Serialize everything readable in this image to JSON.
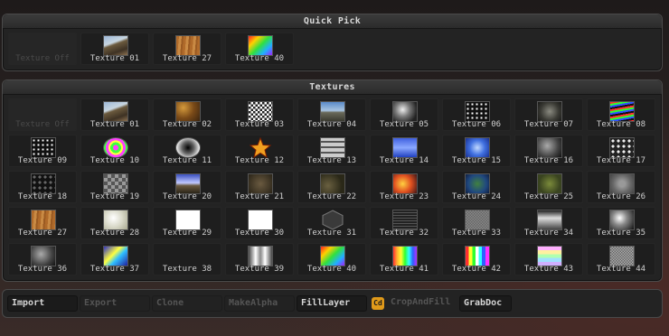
{
  "quick_pick": {
    "title": "Quick Pick",
    "items": [
      {
        "label": "Texture Off",
        "tex": "off"
      },
      {
        "label": "Texture 01",
        "tex": "rock"
      },
      {
        "label": "Texture 27",
        "tex": "wood"
      },
      {
        "label": "Texture 40",
        "tex": "rainbow"
      }
    ]
  },
  "textures": {
    "title": "Textures",
    "items": [
      {
        "label": "Texture Off",
        "tex": "off"
      },
      {
        "label": "Texture 01",
        "tex": "rock"
      },
      {
        "label": "Texture 02",
        "tex": "brown"
      },
      {
        "label": "Texture 03",
        "tex": "checker"
      },
      {
        "label": "Texture 04",
        "tex": "sky"
      },
      {
        "label": "Texture 05",
        "tex": "grunge"
      },
      {
        "label": "Texture 06",
        "tex": "dots"
      },
      {
        "label": "Texture 07",
        "tex": "stone"
      },
      {
        "label": "Texture 08",
        "tex": "lines"
      },
      {
        "label": "Texture 09",
        "tex": "dots"
      },
      {
        "label": "Texture 10",
        "tex": "rings"
      },
      {
        "label": "Texture 11",
        "tex": "radial"
      },
      {
        "label": "Texture 12",
        "tex": "star"
      },
      {
        "label": "Texture 13",
        "tex": "panels"
      },
      {
        "label": "Texture 14",
        "tex": "water"
      },
      {
        "label": "Texture 15",
        "tex": "swirl"
      },
      {
        "label": "Texture 16",
        "tex": "cloud"
      },
      {
        "label": "Texture 17",
        "tex": "spots"
      },
      {
        "label": "Texture 18",
        "tex": "darkspots"
      },
      {
        "label": "Texture 19",
        "tex": "checkgray"
      },
      {
        "label": "Texture 20",
        "tex": "horizon"
      },
      {
        "label": "Texture 21",
        "tex": "dirt"
      },
      {
        "label": "Texture 22",
        "tex": "camo"
      },
      {
        "label": "Texture 23",
        "tex": "fire"
      },
      {
        "label": "Texture 24",
        "tex": "globe"
      },
      {
        "label": "Texture 25",
        "tex": "moss"
      },
      {
        "label": "Texture 26",
        "tex": "granite"
      },
      {
        "label": "Texture 27",
        "tex": "wood"
      },
      {
        "label": "Texture 28",
        "tex": "marble"
      },
      {
        "label": "Texture 29",
        "tex": "logo"
      },
      {
        "label": "Texture 30",
        "tex": "zlogo"
      },
      {
        "label": "Texture 31",
        "tex": "hex"
      },
      {
        "label": "Texture 32",
        "tex": "mesh"
      },
      {
        "label": "Texture 33",
        "tex": "noise"
      },
      {
        "label": "Texture 34",
        "tex": "smoke"
      },
      {
        "label": "Texture 35",
        "tex": "cloudbw"
      },
      {
        "label": "Texture 36",
        "tex": "cloud"
      },
      {
        "label": "Texture 37",
        "tex": "stripes"
      },
      {
        "label": "Texture 38",
        "tex": "blank"
      },
      {
        "label": "Texture 39",
        "tex": "cylinder"
      },
      {
        "label": "Texture 40",
        "tex": "rainbow"
      },
      {
        "label": "Texture 41",
        "tex": "vbars"
      },
      {
        "label": "Texture 42",
        "tex": "vbars2"
      },
      {
        "label": "Texture 43",
        "tex": "hbars"
      },
      {
        "label": "Texture 44",
        "tex": "fineChecker"
      }
    ]
  },
  "toolbar": {
    "import": "Import",
    "export": "Export",
    "clone": "Clone",
    "makealpha": "MakeAlpha",
    "filllayer": "FillLayer",
    "cd": "Cd",
    "cropandfill": "CropAndFill",
    "grabdoc": "GrabDoc"
  },
  "colors": {
    "accent": "#e09a1a",
    "panel": "#232323",
    "label": "#cfcfcf"
  }
}
